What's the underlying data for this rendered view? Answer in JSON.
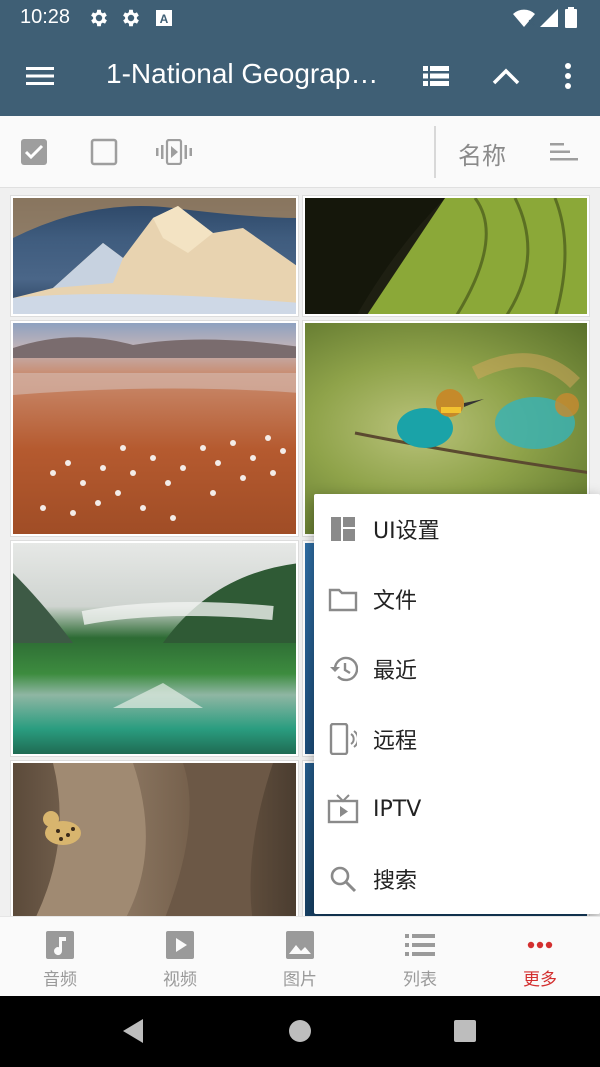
{
  "status_bar": {
    "time": "10:28",
    "icons": [
      "settings-icon",
      "settings-icon",
      "keyboard-a-icon",
      "wifi-icon",
      "signal-icon",
      "battery-icon"
    ]
  },
  "app_bar": {
    "title": "1-National Geograp…",
    "icons": [
      "menu-icon",
      "list-view-icon",
      "chevron-up-icon",
      "more-vert-icon"
    ],
    "color": "#3f5f75"
  },
  "toolbar": {
    "sort_label": "名称",
    "icons": [
      "select-all-checkbox-icon",
      "deselect-checkbox-icon",
      "vibrate-icon",
      "sort-icon"
    ]
  },
  "popup_menu": {
    "items": [
      {
        "label": "UI设置",
        "icon": "dashboard-icon"
      },
      {
        "label": "文件",
        "icon": "folder-icon"
      },
      {
        "label": "最近",
        "icon": "history-icon"
      },
      {
        "label": "远程",
        "icon": "phone-cast-icon"
      },
      {
        "label": "IPTV",
        "icon": "tv-icon"
      },
      {
        "label": "搜索",
        "icon": "search-icon"
      }
    ]
  },
  "bottom_nav": {
    "tabs": [
      {
        "label": "音频",
        "icon": "music-icon",
        "active": false
      },
      {
        "label": "视频",
        "icon": "video-icon",
        "active": false
      },
      {
        "label": "图片",
        "icon": "image-icon",
        "active": false
      },
      {
        "label": "列表",
        "icon": "list-icon",
        "active": false
      },
      {
        "label": "更多",
        "icon": "more-horiz-icon",
        "active": true
      }
    ],
    "active_color": "#d32f2f",
    "inactive_color": "#9a9a9a"
  },
  "photos": [
    "snowy-mountain-photo",
    "green-terraces-photo",
    "flamingo-lake-photo",
    "bee-eater-birds-photo",
    "misty-lake-photo",
    "ocean-photo",
    "leopard-tree-photo",
    "ocean-photo-2"
  ]
}
